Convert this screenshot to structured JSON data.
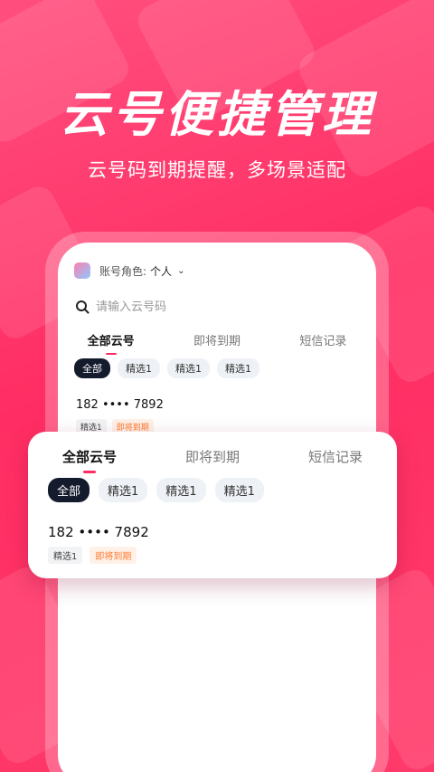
{
  "hero": {
    "title": "云号便捷管理",
    "subtitle": "云号码到期提醒，多场景适配"
  },
  "account": {
    "label": "账号角色:",
    "value": "个人"
  },
  "search": {
    "placeholder": "请输入云号码"
  },
  "tabs": [
    "全部云号",
    "即将到期",
    "短信记录"
  ],
  "filters": [
    "全部",
    "精选1",
    "精选1",
    "精选1"
  ],
  "number_item": {
    "number": "182 •••• 7892",
    "tags": [
      "精选1",
      "即将到期"
    ]
  },
  "colors": {
    "accent": "#ff2d63",
    "chip_active": "#141b2d",
    "warn_text": "#ff7a2e"
  }
}
